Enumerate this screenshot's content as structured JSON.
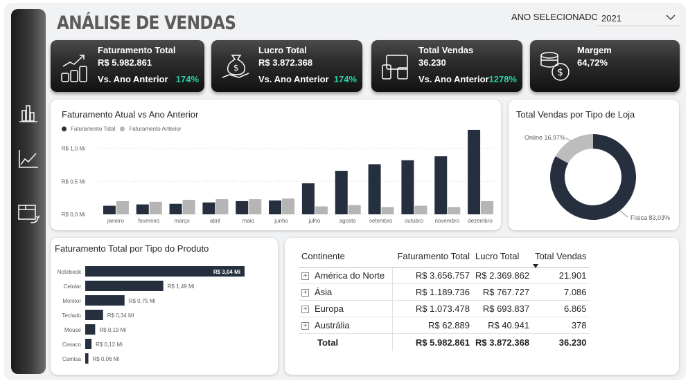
{
  "header": {
    "title": "ANÁLISE DE VENDAS",
    "year_label": "ANO SELECIONADO:",
    "year_value": "2021"
  },
  "sidebar": {
    "icons": [
      "bar-chart-icon",
      "line-chart-icon",
      "box-return-icon"
    ]
  },
  "kpis": [
    {
      "title": "Faturamento Total",
      "value": "R$ 5.982.861",
      "compare": "Vs. Ano Anterior",
      "pct": "174%",
      "icon": "coins-growth-icon"
    },
    {
      "title": "Lucro Total",
      "value": "R$ 3.872.368",
      "compare": "Vs. Ano Anterior",
      "pct": "174%",
      "icon": "money-bag-hand-icon"
    },
    {
      "title": "Total Vendas",
      "value": "36.230",
      "compare": "Vs. Ano Anterior",
      "pct": "1278%",
      "icon": "devices-icon"
    },
    {
      "title": "Margem",
      "value": "64,72%",
      "compare": "",
      "pct": "",
      "icon": "coins-dollar-icon"
    }
  ],
  "colors": {
    "dark": "#252f3d",
    "gray": "#b5b5b5",
    "accent": "#27d3a6"
  },
  "chart_data": [
    {
      "type": "bar",
      "title": "Faturamento Atual vs Ano Anterior",
      "categories": [
        "janeiro",
        "fevereiro",
        "março",
        "abril",
        "maio",
        "junho",
        "julho",
        "agosto",
        "setembro",
        "outubro",
        "novembro",
        "dezembro"
      ],
      "series": [
        {
          "name": "Faturamento Total",
          "values": [
            0.13,
            0.15,
            0.16,
            0.18,
            0.2,
            0.21,
            0.47,
            0.66,
            0.76,
            0.82,
            0.88,
            1.28
          ]
        },
        {
          "name": "Faturamento Anterior",
          "values": [
            0.2,
            0.19,
            0.22,
            0.23,
            0.23,
            0.24,
            0.12,
            0.14,
            0.11,
            0.13,
            0.11,
            0.2
          ]
        }
      ],
      "yticks": [
        "R$ 0,0 Mi",
        "R$ 0,5 Mi",
        "R$ 1,0 Mi"
      ],
      "ylim": [
        0,
        1.3
      ],
      "grid": true,
      "legend": "top-left"
    },
    {
      "type": "pie",
      "title": "Total Vendas por Tipo de Loja",
      "labels": [
        "Física",
        "Online"
      ],
      "values": [
        83.03,
        16.97
      ],
      "data_labels": [
        "Física 83,03%",
        "Online 16,97%"
      ]
    },
    {
      "type": "bar",
      "orientation": "horizontal",
      "title": "Faturamento Total por Tipo do Produto",
      "categories": [
        "Notebook",
        "Celular",
        "Monitor",
        "Teclado",
        "Mouse",
        "Casaco",
        "Camisa"
      ],
      "values": [
        3.04,
        1.49,
        0.75,
        0.34,
        0.19,
        0.12,
        0.06
      ],
      "data_labels": [
        "R$ 3,04 Mi",
        "R$ 1,49 Mi",
        "R$ 0,75 Mi",
        "R$ 0,34 Mi",
        "R$ 0,19 Mi",
        "R$ 0,12 Mi",
        "R$ 0,06 Mi"
      ]
    }
  ],
  "table": {
    "headers": [
      "Continente",
      "Faturamento Total",
      "Lucro Total",
      "Total Vendas"
    ],
    "rows": [
      {
        "continent": "América do Norte",
        "revenue": "R$ 3.656.757",
        "profit": "R$ 2.369.862",
        "sales": "21.901"
      },
      {
        "continent": "Ásia",
        "revenue": "R$ 1.189.736",
        "profit": "R$ 767.727",
        "sales": "7.086"
      },
      {
        "continent": "Europa",
        "revenue": "R$ 1.073.478",
        "profit": "R$ 693.837",
        "sales": "6.865"
      },
      {
        "continent": "Austrália",
        "revenue": "R$ 62.889",
        "profit": "R$ 40.941",
        "sales": "378"
      }
    ],
    "total": {
      "label": "Total",
      "revenue": "R$ 5.982.861",
      "profit": "R$ 3.872.368",
      "sales": "36.230"
    }
  }
}
